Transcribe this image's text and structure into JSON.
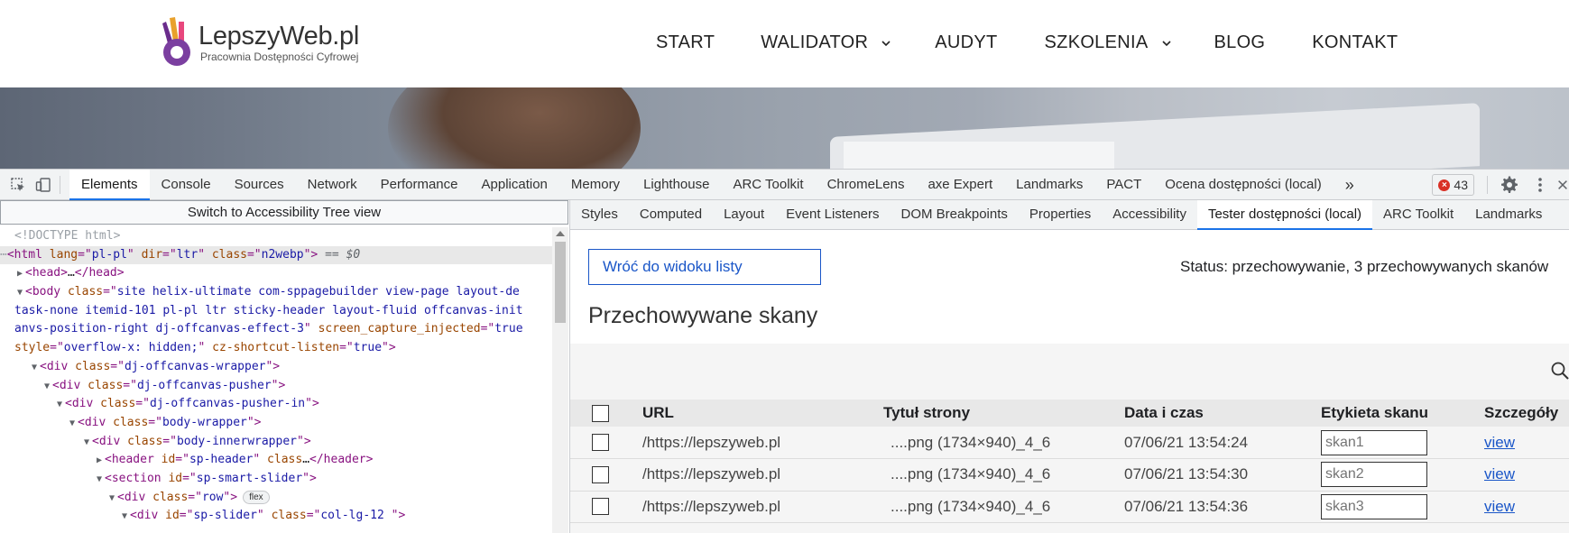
{
  "site": {
    "logo_name": "LepszyWeb.pl",
    "logo_tagline": "Pracownia Dostępności Cyfrowej",
    "nav": [
      {
        "label": "START",
        "has_dropdown": false
      },
      {
        "label": "WALIDATOR",
        "has_dropdown": true
      },
      {
        "label": "AUDYT",
        "has_dropdown": false
      },
      {
        "label": "SZKOLENIA",
        "has_dropdown": true
      },
      {
        "label": "BLOG",
        "has_dropdown": false
      },
      {
        "label": "KONTAKT",
        "has_dropdown": false
      }
    ]
  },
  "devtools": {
    "tabs": [
      "Elements",
      "Console",
      "Sources",
      "Network",
      "Performance",
      "Application",
      "Memory",
      "Lighthouse",
      "ARC Toolkit",
      "ChromeLens",
      "axe Expert",
      "Landmarks",
      "PACT",
      "Ocena dostępności (local)"
    ],
    "active_tab": "Elements",
    "more_tabs": "»",
    "error_count": "43",
    "icons": [
      "inspect-icon",
      "device-toolbar-icon",
      "settings-icon",
      "more-icon",
      "close-icon"
    ]
  },
  "elements": {
    "a11y_switch": "Switch to Accessibility Tree view",
    "dom": {
      "doctype": "<!DOCTYPE html>",
      "l1": {
        "lang": "pl-pl",
        "dir": "ltr",
        "class": "n2webp",
        "eq": "== $0"
      },
      "l2": "…",
      "l3_class_a": "site helix-ultimate com-sppagebuilder view-page layout-de",
      "l3_class_b": "task-none itemid-101 pl-pl ltr sticky-header layout-fluid offcanvas-init",
      "l3_class_c": "anvs-position-right dj-offcanvas-effect-3",
      "l3_attr": "screen_capture_injected",
      "l3_attr_val": "true",
      "l3_style": "overflow-x: hidden;",
      "l3_cz": "cz-shortcut-listen",
      "l3_cz_val": "true",
      "wrapper": "dj-offcanvas-wrapper",
      "pusher": "dj-offcanvas-pusher",
      "pusher_in": "dj-offcanvas-pusher-in",
      "body_wrapper": "body-wrapper",
      "body_inner": "body-innerwrapper",
      "header_id": "sp-header",
      "header_ell": "…",
      "section_id": "sp-smart-slider",
      "row_class": "row",
      "flex_badge": "flex",
      "slider_id": "sp-slider",
      "slider_class": "col-lg-12 "
    }
  },
  "sidebar": {
    "tabs": [
      "Styles",
      "Computed",
      "Layout",
      "Event Listeners",
      "DOM Breakpoints",
      "Properties",
      "Accessibility",
      "Tester dostępności (local)",
      "ARC Toolkit",
      "Landmarks"
    ],
    "active_tab": "Tester dostępności (local)",
    "back_button": "Wróć do widoku listy",
    "status": "Status: przechowywanie, 3 przechowywanych skanów",
    "title": "Przechowywane skany",
    "table": {
      "headers": [
        "URL",
        "Tytuł strony",
        "Data i czas",
        "Etykieta skanu",
        "Szczegóły"
      ],
      "rows": [
        {
          "url": "/https://lepszyweb.pl",
          "title": "....png (1734×940)_4_6",
          "datetime": "07/06/21 13:54:24",
          "label": "skan1",
          "details": "view"
        },
        {
          "url": "/https://lepszyweb.pl",
          "title": "....png (1734×940)_4_6",
          "datetime": "07/06/21 13:54:30",
          "label": "skan2",
          "details": "view"
        },
        {
          "url": "/https://lepszyweb.pl",
          "title": "....png (1734×940)_4_6",
          "datetime": "07/06/21 13:54:36",
          "label": "skan3",
          "details": "view"
        }
      ]
    }
  },
  "colors": {
    "accent_blue": "#1a73e8",
    "link_blue": "#1a56c8",
    "error_red": "#d93025",
    "tag_purple": "#881280",
    "attr_brown": "#994500",
    "value_blue": "#1a1aa6"
  }
}
